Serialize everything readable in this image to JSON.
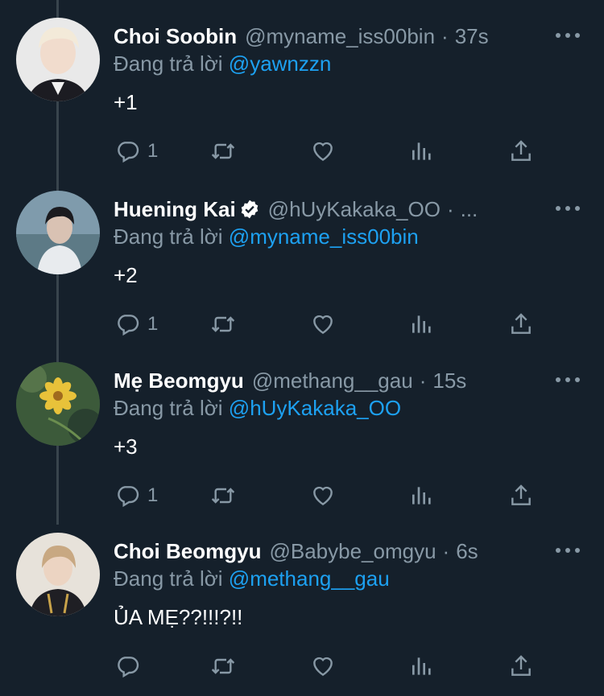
{
  "colors": {
    "background": "#15202b",
    "text_primary": "#ffffff",
    "text_secondary": "#8899a6",
    "mention": "#1da1f2",
    "thread_line": "#38444d"
  },
  "reply_prefix": "Đang trả lời",
  "tweets": [
    {
      "name": "Choi Soobin",
      "handle": "@myname_iss00bin",
      "separator": "·",
      "time": "37s",
      "reply_to": "@yawnzzn",
      "text": "+1",
      "reply_count": "1",
      "verified": false
    },
    {
      "name": "Huening Kai",
      "handle": "@hUyKakaka_OO",
      "separator": "·",
      "time": "...",
      "reply_to": "@myname_iss00bin",
      "text": "+2",
      "reply_count": "1",
      "verified": true
    },
    {
      "name": "Mẹ Beomgyu",
      "handle": "@methang__gau",
      "separator": "·",
      "time": "15s",
      "reply_to": "@hUyKakaka_OO",
      "text": "+3",
      "reply_count": "1",
      "verified": false
    },
    {
      "name": "Choi Beomgyu",
      "handle": "@Babybe_omgyu",
      "separator": "·",
      "time": "6s",
      "reply_to": "@methang__gau",
      "text": "ỦA MẸ??!!!?!!",
      "reply_count": "",
      "verified": false
    }
  ],
  "icons": [
    "reply-icon",
    "retweet-icon",
    "like-icon",
    "stats-icon",
    "share-icon",
    "more-icon",
    "verified-icon"
  ]
}
